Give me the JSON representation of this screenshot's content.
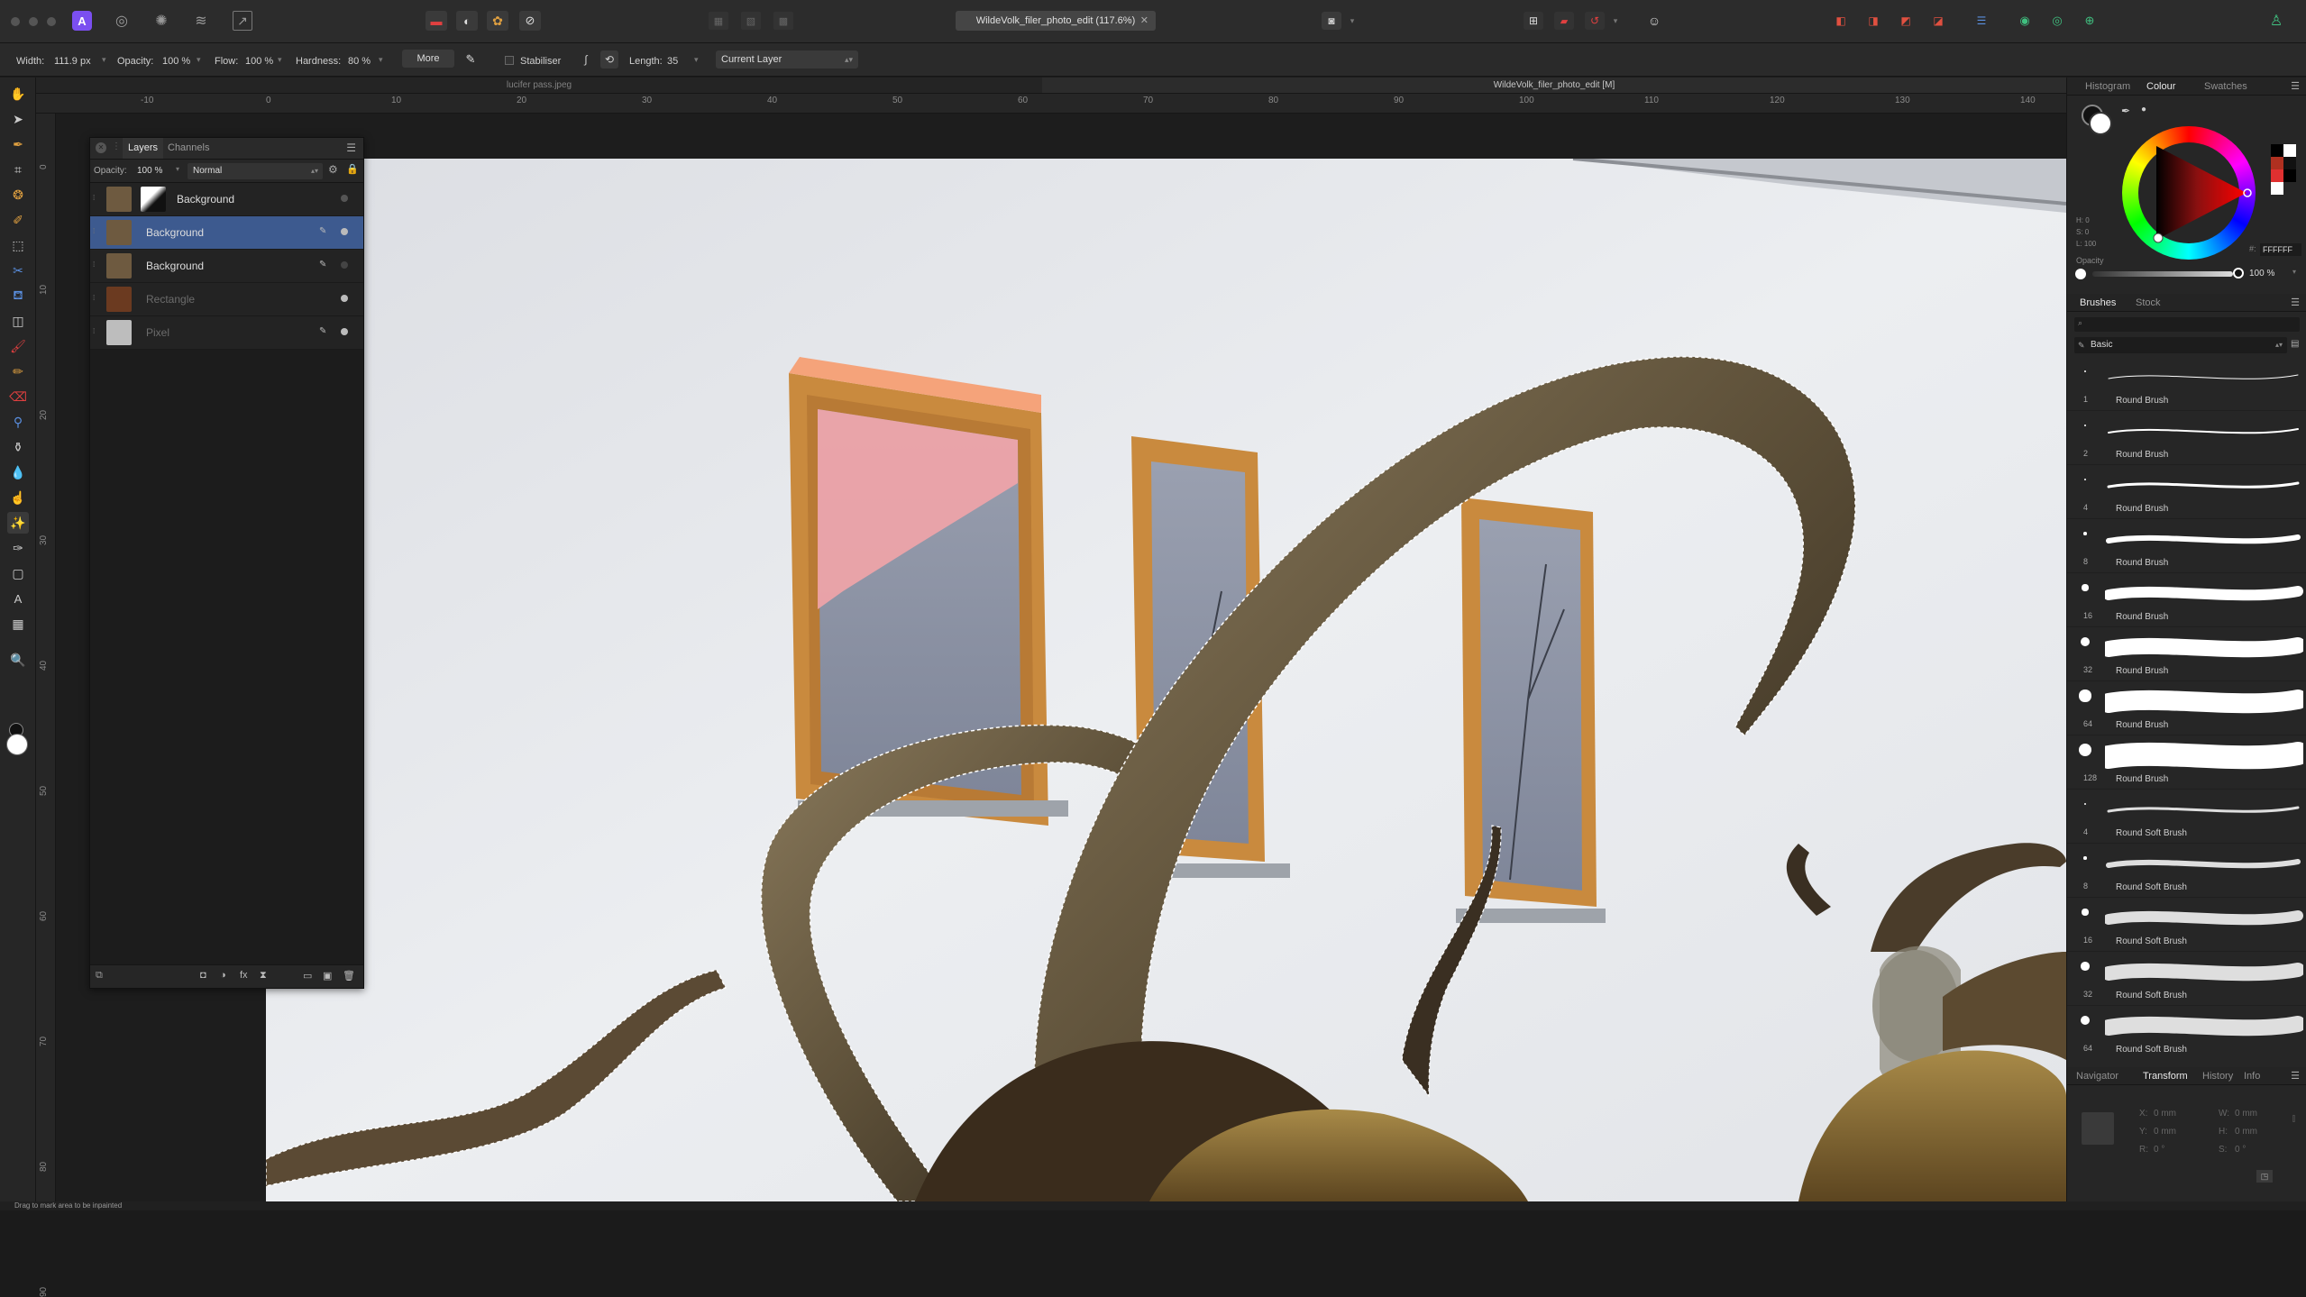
{
  "document": {
    "title": "WildeVolk_filer_photo_edit (117.6%)"
  },
  "tabs": {
    "inactive": "lucifer pass.jpeg",
    "active": "WildeVolk_filer_photo_edit [M]"
  },
  "context": {
    "width_label": "Width:",
    "width_value": "111.9 px",
    "opacity_label": "Opacity:",
    "opacity_value": "100 %",
    "flow_label": "Flow:",
    "flow_value": "100 %",
    "hardness_label": "Hardness:",
    "hardness_value": "80 %",
    "more_button": "More",
    "stabiliser_label": "Stabiliser",
    "length_label": "Length:",
    "length_value": "35",
    "target_select": "Current Layer"
  },
  "ruler": {
    "unit": "mm",
    "h_ticks": [
      "-10",
      "0",
      "10",
      "20",
      "30",
      "40",
      "50",
      "60",
      "70",
      "80",
      "90",
      "100",
      "110",
      "120",
      "130",
      "140"
    ],
    "v_ticks": [
      "0",
      "10",
      "20",
      "30",
      "40",
      "50",
      "60",
      "70",
      "80",
      "90"
    ]
  },
  "layers_panel": {
    "tabs": [
      "Layers",
      "Channels"
    ],
    "opacity_label": "Opacity:",
    "opacity_value": "100 %",
    "blend_mode": "Normal",
    "items": [
      {
        "name": "Background",
        "dim": false,
        "selected": false
      },
      {
        "name": "Background",
        "dim": false,
        "selected": true
      },
      {
        "name": "Background",
        "dim": false,
        "selected": false
      },
      {
        "name": "Rectangle",
        "dim": true,
        "selected": false
      },
      {
        "name": "Pixel",
        "dim": true,
        "selected": false
      }
    ]
  },
  "colour_panel": {
    "tabs": [
      "Histogram",
      "Colour",
      "Swatches"
    ],
    "readout": [
      "H: 0",
      "S: 0",
      "L: 100"
    ],
    "hex_label": "#:",
    "hex_value": "FFFFFF",
    "opacity_label": "Opacity",
    "opacity_value": "100 %",
    "accent": "#3d5a8f"
  },
  "brushes_panel": {
    "tabs": [
      "Brushes",
      "Stock"
    ],
    "category": "Basic",
    "items": [
      {
        "size": "1",
        "name": "Round Brush"
      },
      {
        "size": "2",
        "name": "Round Brush"
      },
      {
        "size": "4",
        "name": "Round Brush"
      },
      {
        "size": "8",
        "name": "Round Brush"
      },
      {
        "size": "16",
        "name": "Round Brush"
      },
      {
        "size": "32",
        "name": "Round Brush"
      },
      {
        "size": "64",
        "name": "Round Brush"
      },
      {
        "size": "128",
        "name": "Round Brush"
      },
      {
        "size": "4",
        "name": "Round Soft Brush"
      },
      {
        "size": "8",
        "name": "Round Soft Brush"
      },
      {
        "size": "16",
        "name": "Round Soft Brush"
      },
      {
        "size": "32",
        "name": "Round Soft Brush"
      },
      {
        "size": "64",
        "name": "Round Soft Brush"
      }
    ]
  },
  "transform_panel": {
    "tabs": [
      "Navigator",
      "Transform",
      "History",
      "Info"
    ],
    "x_label": "X:",
    "x_value": "0 mm",
    "y_label": "Y:",
    "y_value": "0 mm",
    "w_label": "W:",
    "w_value": "0 mm",
    "h_label": "H:",
    "h_value": "0 mm",
    "r_label": "R:",
    "r_value": "0 °",
    "s_label": "S:",
    "s_value": "0 °"
  },
  "status": {
    "text": "Drag to mark area to be inpainted"
  }
}
